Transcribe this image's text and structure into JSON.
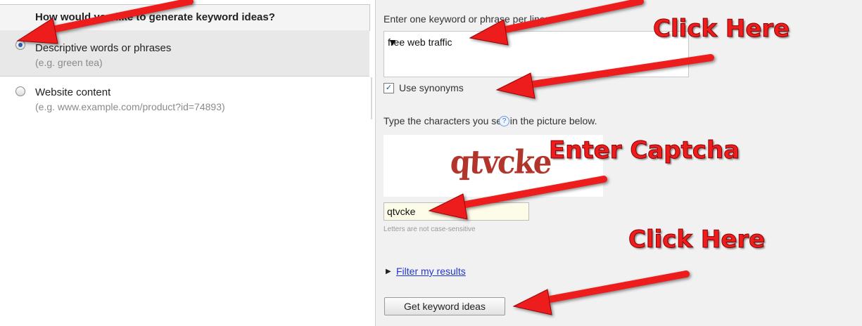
{
  "left_panel": {
    "header": "How would you like to generate keyword ideas?",
    "options": [
      {
        "label": "Descriptive words or phrases",
        "example": "(e.g. green tea)",
        "selected": true
      },
      {
        "label": "Website content",
        "example": "(e.g. www.example.com/product?id=74893)",
        "selected": false
      }
    ]
  },
  "right_panel": {
    "keyword_prompt": "Enter one keyword or phrase per line:",
    "keyword_value": "free web traffic",
    "use_synonyms_label": "Use synonyms",
    "use_synonyms_checked": true,
    "captcha_prompt": "Type the characters you see in the picture below.",
    "help_icon": "?",
    "captcha_image_text": "qtvcke",
    "captcha_input_value": "qtvcke",
    "captcha_hint": "Letters are not case-sensitive",
    "filter_link": "Filter my results",
    "submit_button": "Get keyword ideas"
  },
  "annotations": {
    "click_here_1": "Click Here",
    "enter_captcha": "Enter Captcha",
    "click_here_2": "Click Here",
    "arrow_color": "#ee1d1d"
  },
  "icons": {
    "radio_selected": "radio-selected-icon",
    "radio_unselected": "radio-unselected-icon",
    "checkbox": "checkbox-checked-icon",
    "help": "help-icon",
    "expand": "triangle-right-icon"
  }
}
